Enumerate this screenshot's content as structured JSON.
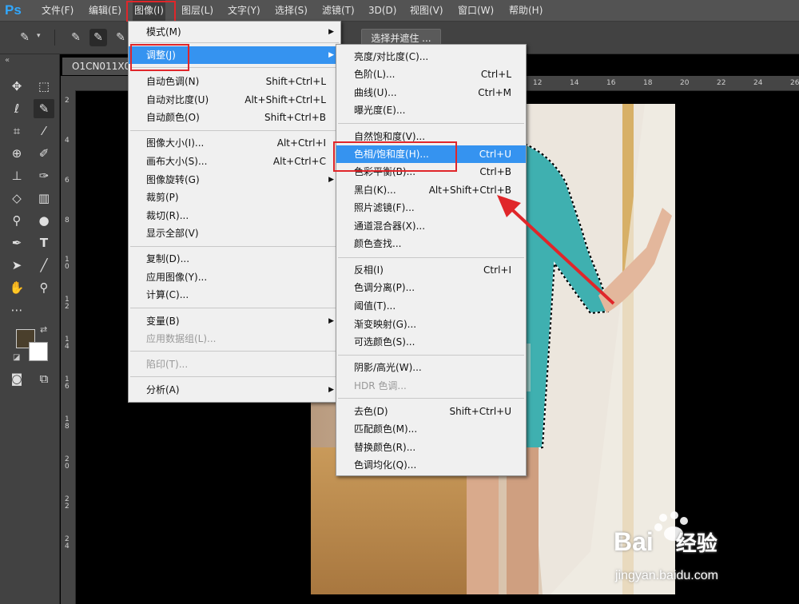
{
  "app": {
    "logo": "Ps"
  },
  "menubar": {
    "items": [
      "文件(F)",
      "编辑(E)",
      "图像(I)",
      "图层(L)",
      "文字(Y)",
      "选择(S)",
      "滤镜(T)",
      "3D(D)",
      "视图(V)",
      "窗口(W)",
      "帮助(H)"
    ],
    "active": "图像(I)"
  },
  "options_bar": {
    "select_mask": "选择并遮住 ..."
  },
  "document": {
    "tab_title": "O1CN011X0"
  },
  "rulers": {
    "h": [
      "12",
      "14",
      "16",
      "18",
      "20",
      "22",
      "24",
      "26"
    ],
    "v": [
      "2",
      "4",
      "6",
      "8",
      "1\n0",
      "1\n2",
      "1\n4",
      "1\n6",
      "1\n8",
      "2\n0",
      "2\n2",
      "2\n4"
    ]
  },
  "image_menu": {
    "items": [
      {
        "label": "模式(M)",
        "shortcut": "",
        "submenu": true
      },
      {
        "label": "调整(J)",
        "shortcut": "",
        "submenu": true
      },
      {
        "label": "自动色调(N)",
        "shortcut": "Shift+Ctrl+L"
      },
      {
        "label": "自动对比度(U)",
        "shortcut": "Alt+Shift+Ctrl+L"
      },
      {
        "label": "自动颜色(O)",
        "shortcut": "Shift+Ctrl+B"
      },
      {
        "label": "图像大小(I)...",
        "shortcut": "Alt+Ctrl+I"
      },
      {
        "label": "画布大小(S)...",
        "shortcut": "Alt+Ctrl+C"
      },
      {
        "label": "图像旋转(G)",
        "shortcut": "",
        "submenu": true
      },
      {
        "label": "裁剪(P)",
        "shortcut": ""
      },
      {
        "label": "裁切(R)...",
        "shortcut": ""
      },
      {
        "label": "显示全部(V)",
        "shortcut": ""
      },
      {
        "label": "复制(D)...",
        "shortcut": ""
      },
      {
        "label": "应用图像(Y)...",
        "shortcut": ""
      },
      {
        "label": "计算(C)...",
        "shortcut": ""
      },
      {
        "label": "变量(B)",
        "shortcut": "",
        "submenu": true
      },
      {
        "label": "应用数据组(L)...",
        "shortcut": "",
        "disabled": true
      },
      {
        "label": "陷印(T)...",
        "shortcut": "",
        "disabled": true
      },
      {
        "label": "分析(A)",
        "shortcut": "",
        "submenu": true
      }
    ]
  },
  "adjust_menu": {
    "items": [
      {
        "label": "亮度/对比度(C)...",
        "shortcut": ""
      },
      {
        "label": "色阶(L)...",
        "shortcut": "Ctrl+L"
      },
      {
        "label": "曲线(U)...",
        "shortcut": "Ctrl+M"
      },
      {
        "label": "曝光度(E)...",
        "shortcut": ""
      },
      {
        "label": "自然饱和度(V)...",
        "shortcut": ""
      },
      {
        "label": "色相/饱和度(H)...",
        "shortcut": "Ctrl+U"
      },
      {
        "label": "色彩平衡(B)...",
        "shortcut": "Ctrl+B"
      },
      {
        "label": "黑白(K)...",
        "shortcut": "Alt+Shift+Ctrl+B"
      },
      {
        "label": "照片滤镜(F)...",
        "shortcut": ""
      },
      {
        "label": "通道混合器(X)...",
        "shortcut": ""
      },
      {
        "label": "颜色查找...",
        "shortcut": ""
      },
      {
        "label": "反相(I)",
        "shortcut": "Ctrl+I"
      },
      {
        "label": "色调分离(P)...",
        "shortcut": ""
      },
      {
        "label": "阈值(T)...",
        "shortcut": ""
      },
      {
        "label": "渐变映射(G)...",
        "shortcut": ""
      },
      {
        "label": "可选颜色(S)...",
        "shortcut": ""
      },
      {
        "label": "阴影/高光(W)...",
        "shortcut": ""
      },
      {
        "label": "HDR 色调...",
        "shortcut": "",
        "disabled": true
      },
      {
        "label": "去色(D)",
        "shortcut": "Shift+Ctrl+U"
      },
      {
        "label": "匹配颜色(M)...",
        "shortcut": ""
      },
      {
        "label": "替换颜色(R)...",
        "shortcut": ""
      },
      {
        "label": "色调均化(Q)...",
        "shortcut": ""
      }
    ]
  },
  "watermark": {
    "brand": "Bai",
    "brand_cn": "经验",
    "url": "jingyan.baidu.com"
  },
  "colors": {
    "highlight": "#3593f0",
    "annotation": "#e0262a",
    "dress": "#3fb0b0"
  }
}
